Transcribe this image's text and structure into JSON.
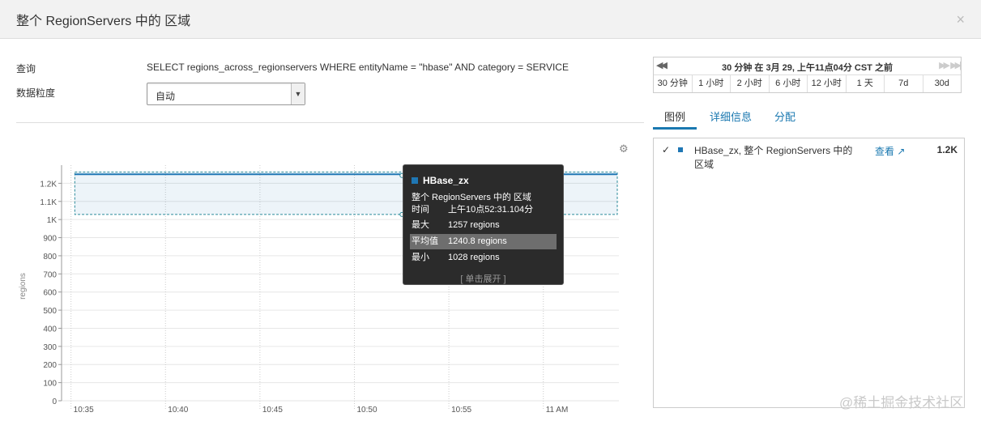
{
  "modal": {
    "title": "整个 RegionServers 中的 区域",
    "close_icon": "close-icon"
  },
  "query": {
    "query_label": "查询",
    "query_value": "SELECT regions_across_regionservers WHERE entityName = \"hbase\" AND category = SERVICE",
    "granularity_label": "数据粒度",
    "granularity_value": "自动"
  },
  "time_nav": {
    "title": "30 分钟 在 3月 29, 上午11点04分 CST 之前",
    "prev_icon": "◀◀",
    "next_icon": "▶▶",
    "last_icon": "▶▶|",
    "ranges": [
      "30 分钟",
      "1 小时",
      "2 小时",
      "6 小时",
      "12 小时",
      "1 天",
      "7d",
      "30d"
    ]
  },
  "tabs": [
    {
      "label": "图例",
      "active": true
    },
    {
      "label": "详细信息",
      "active": false
    },
    {
      "label": "分配",
      "active": false
    }
  ],
  "legend": {
    "check": "✓",
    "series_name": "HBase_zx, 整个 RegionServers 中的 区域",
    "view_label": "查看 ↗",
    "value": "1.2K",
    "color": "#1f77b4"
  },
  "tooltip": {
    "series": "HBase_zx",
    "metric": "整个 RegionServers 中的 区域",
    "rows": [
      {
        "k": "时间",
        "v": "上午10点52:31.104分"
      },
      {
        "k": "最大",
        "v": "1257 regions"
      },
      {
        "k": "平均值",
        "v": "1240.8 regions"
      },
      {
        "k": "最小",
        "v": "1028 regions"
      }
    ],
    "expand": "[ 单击展开 ]"
  },
  "chart_data": {
    "type": "line",
    "ylabel": "regions",
    "ylim": [
      0,
      1300
    ],
    "yticks": [
      "0",
      "100",
      "200",
      "300",
      "400",
      "500",
      "600",
      "700",
      "800",
      "900",
      "1K",
      "1.1K",
      "1.2K"
    ],
    "ytick_values": [
      0,
      100,
      200,
      300,
      400,
      500,
      600,
      700,
      800,
      900,
      1000,
      1100,
      1200
    ],
    "xticks": [
      "10:35",
      "10:40",
      "10:45",
      "10:50",
      "10:55",
      "11 AM"
    ],
    "xtick_minutes": [
      35,
      40,
      45,
      50,
      55,
      60
    ],
    "xlim_minutes": [
      34.5,
      64
    ],
    "series": [
      {
        "name": "HBase_zx",
        "mean": 1250,
        "max": 1262,
        "min": 1028,
        "color": "#1f77b4"
      }
    ],
    "highlight_minute": 52.52,
    "grid": true
  },
  "watermark": "@稀土掘金技术社区",
  "gear_icon": "gear-icon"
}
